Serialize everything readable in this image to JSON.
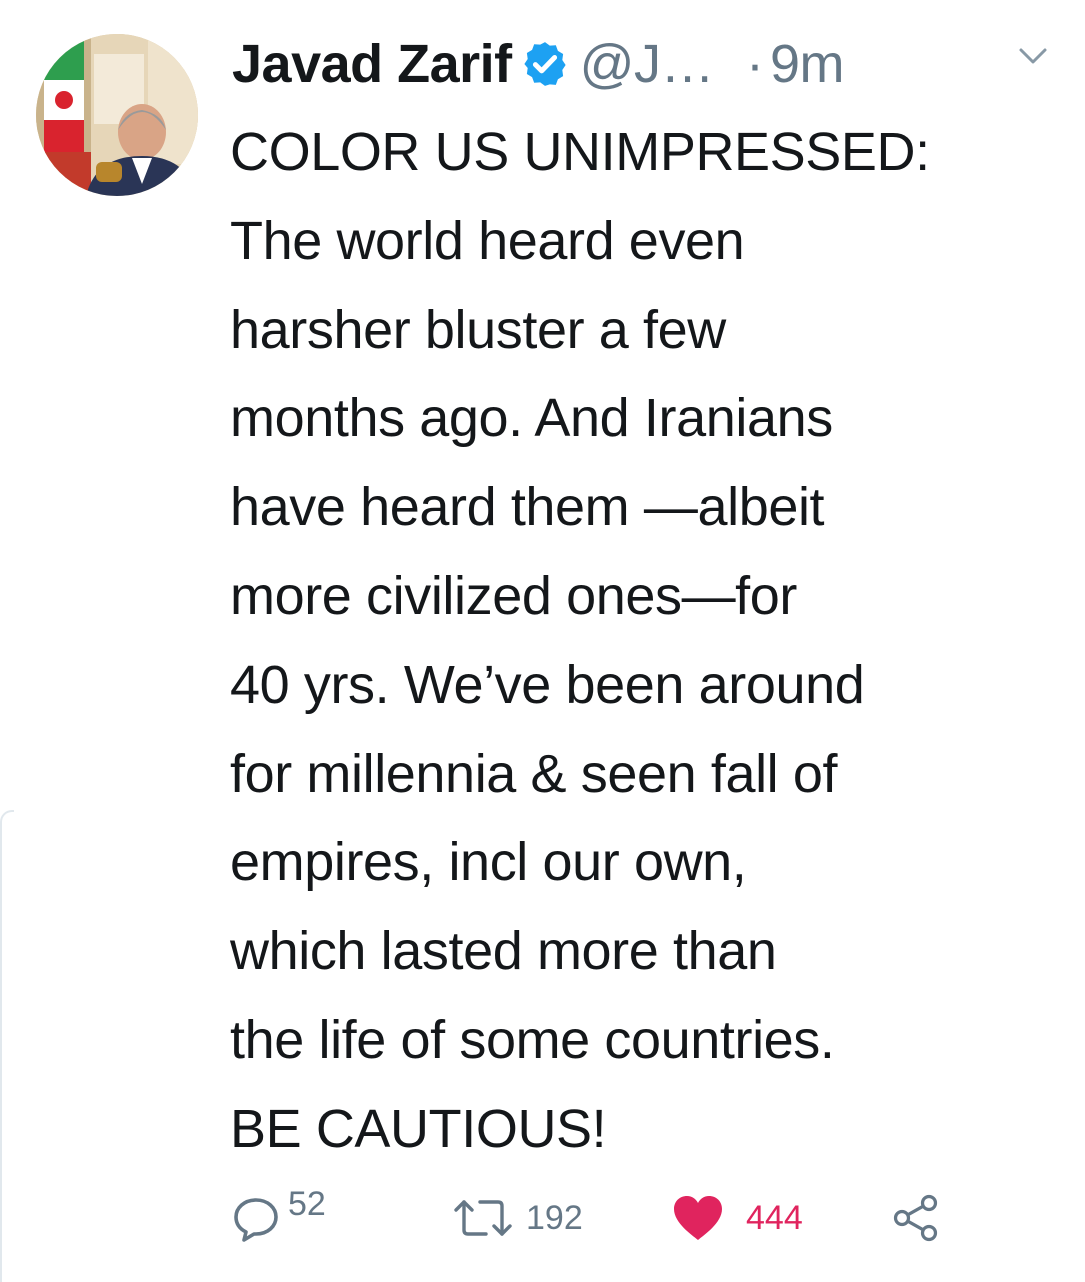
{
  "tweet": {
    "author_name": "Javad Zarif",
    "handle": "@J…",
    "separator": "·",
    "time": "9m",
    "body_lines": [
      "COLOR US UNIMPRESSED:",
      "The world heard even",
      "harsher bluster a few",
      "months ago. And Iranians",
      "have heard them —albeit",
      "more civilized ones—for",
      "40 yrs. We’ve been around",
      "for millennia & seen fall of",
      "empires, incl our own,",
      "which lasted more than",
      "the life of some countries.",
      "BE CAUTIOUS!"
    ],
    "actions": {
      "replies": "52",
      "retweets": "192",
      "likes": "444"
    }
  },
  "icons": {
    "verified": "verified-badge-icon",
    "caret": "chevron-down-icon",
    "reply": "reply-icon",
    "retweet": "retweet-icon",
    "like": "heart-icon",
    "share": "share-icon"
  },
  "colors": {
    "text": "#14171a",
    "secondary": "#657786",
    "verified_blue": "#1da1f2",
    "like_red": "#e0245e"
  }
}
